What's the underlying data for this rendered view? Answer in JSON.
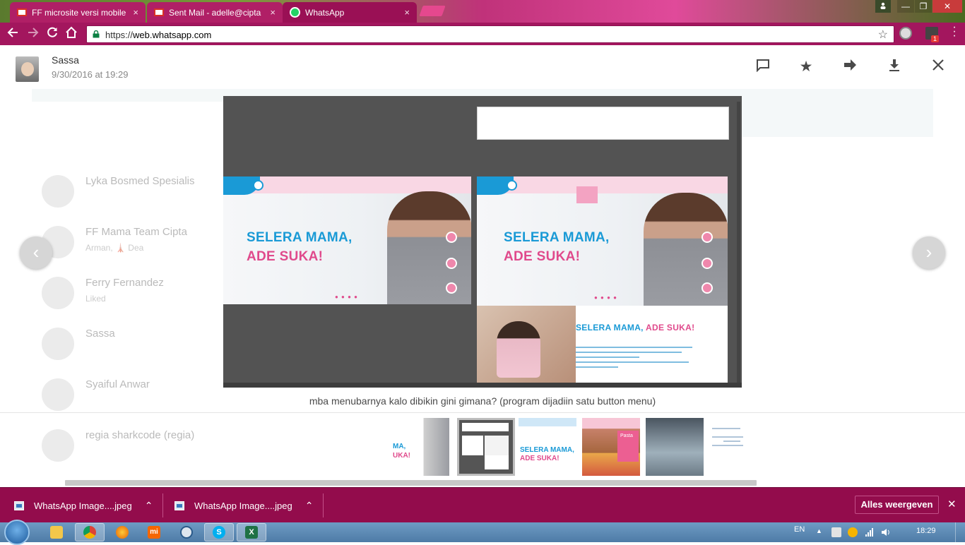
{
  "browser": {
    "tabs": [
      {
        "title": "FF microsite versi mobile",
        "favicon": "gmail-icon",
        "active": false
      },
      {
        "title": "Sent Mail - adelle@cipta",
        "favicon": "gmail-icon",
        "active": false
      },
      {
        "title": "WhatsApp",
        "favicon": "whatsapp-icon",
        "active": true
      }
    ],
    "tab_close_glyph": "×",
    "url_scheme": "https://",
    "url_host": "web.whatsapp.com",
    "extension_badge": "1",
    "window_controls": {
      "minimize": "—",
      "maximize": "❐",
      "close": "✕"
    }
  },
  "background_chats": [
    {
      "name": "Lyka Bosmed Spesialis",
      "snippet": ""
    },
    {
      "name": "FF Mama Team Cipta",
      "snippet": "Arman, 🗼 Dea"
    },
    {
      "name": "Ferry Fernandez",
      "snippet": "Liked"
    },
    {
      "name": "Sassa",
      "snippet": ""
    },
    {
      "name": "Syaiful Anwar",
      "snippet": ""
    },
    {
      "name": "regia sharkcode (regia)",
      "snippet": ""
    }
  ],
  "viewer": {
    "sender_name": "Sassa",
    "timestamp": "9/30/2016 at 19:29",
    "header_icons": [
      "comment-icon",
      "star-icon",
      "forward-icon",
      "download-icon",
      "close-icon"
    ],
    "caption": "mba menubarnya kalo dibikin gini gimana? (program dijadiin satu button menu)",
    "image": {
      "headline_line1": "SELERA MAMA,",
      "headline_line2": "ADE SUKA!",
      "lower_title_blue": "SELERA MAMA, ",
      "lower_title_pink": "ADE SUKA!",
      "slider_dots": "● ● ● ●"
    },
    "prev_arrow": "‹",
    "next_arrow": "›",
    "thumbnails": [
      {
        "label_blue": "MA,",
        "label_pink": "UKA!"
      },
      {
        "label_blue": "",
        "label_pink": ""
      },
      {
        "label_blue": "SELERA MAMA,",
        "label_pink": "ADE SUKA!"
      },
      {
        "label_blue": "",
        "label_pink": "Pasta"
      },
      {
        "label_blue": "",
        "label_pink": ""
      },
      {
        "label_blue": "",
        "label_pink": ""
      }
    ]
  },
  "downloads": {
    "items": [
      {
        "filename": "WhatsApp Image....jpeg"
      },
      {
        "filename": "WhatsApp Image....jpeg"
      }
    ],
    "show_all_label": "Alles weergeven",
    "close_glyph": "✕",
    "chevron_glyph": "⌃"
  },
  "taskbar": {
    "language": "EN",
    "clock": "18:29",
    "apps": [
      "file-explorer-icon",
      "chrome-icon",
      "firefox-icon",
      "mi-icon",
      "network-icon",
      "skype-icon",
      "excel-icon"
    ],
    "mi_label": "mi",
    "excel_label": "X",
    "skype_label": "S"
  },
  "colors": {
    "browser_frame": "#a3165e",
    "downloads_bar": "#930c4c",
    "brand_blue": "#1a9ad6",
    "brand_pink": "#e04a8c",
    "whatsapp_green": "#25d366"
  }
}
